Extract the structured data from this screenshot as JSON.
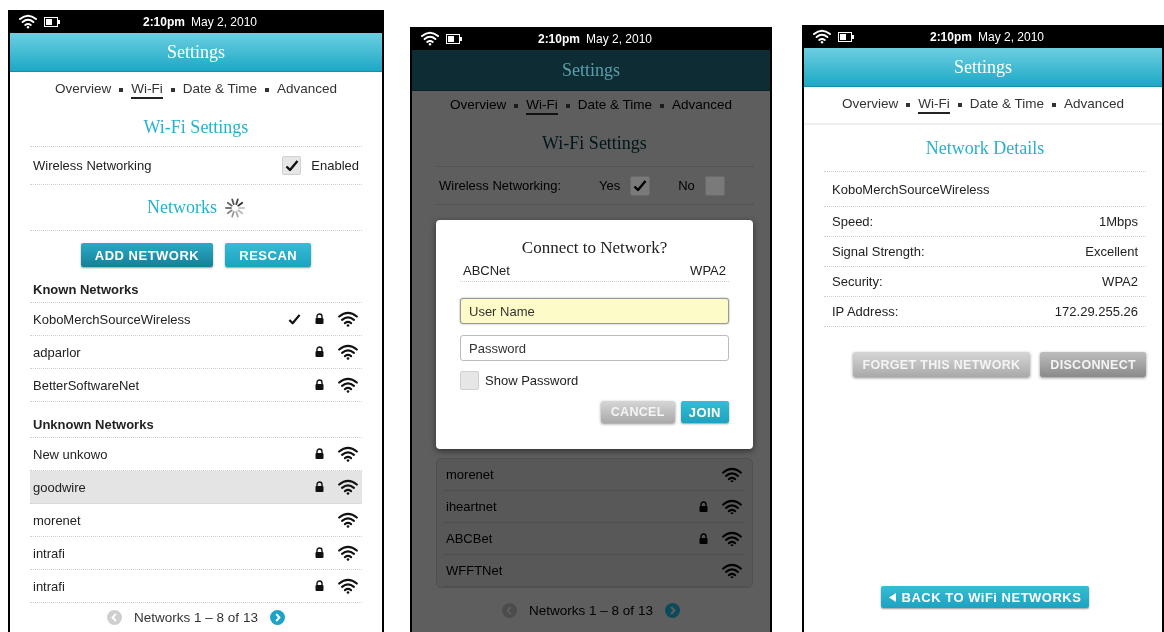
{
  "screens": [
    {
      "kind": "wifi_settings",
      "status_bar": {
        "time": "2:10pm",
        "date": "May 2, 2010"
      },
      "header": "Settings",
      "tabs": [
        {
          "label": "Overview",
          "selected": false
        },
        {
          "label": "Wi-Fi",
          "selected": true
        },
        {
          "label": "Date & Time",
          "selected": false
        },
        {
          "label": "Advanced",
          "selected": false
        }
      ],
      "section_title": "Wi-Fi Settings",
      "wireless": {
        "label": "Wireless Networking",
        "checked": true,
        "option": "Enabled"
      },
      "networks_title": "Networks",
      "loading": true,
      "buttons": [
        "ADD NETWORK",
        "RESCAN"
      ],
      "groups": [
        {
          "title": "Known Networks",
          "networks": [
            {
              "name": "KoboMerchSourceWireless",
              "connected": true,
              "locked": true,
              "selected": false
            },
            {
              "name": "adparlor",
              "connected": false,
              "locked": true,
              "selected": false
            },
            {
              "name": "BetterSoftwareNet",
              "connected": false,
              "locked": true,
              "selected": false
            }
          ]
        },
        {
          "title": "Unknown Networks",
          "networks": [
            {
              "name": "New unkowo",
              "connected": false,
              "locked": true,
              "selected": false
            },
            {
              "name": "goodwire",
              "connected": false,
              "locked": true,
              "selected": true
            },
            {
              "name": "morenet",
              "connected": false,
              "locked": false,
              "selected": false
            },
            {
              "name": "intrafi",
              "connected": false,
              "locked": true,
              "selected": false
            },
            {
              "name": "intrafi",
              "connected": false,
              "locked": true,
              "selected": false
            }
          ]
        }
      ],
      "pager": {
        "text": "Networks 1 – 8 of 13",
        "prev_disabled": true,
        "next_disabled": false
      }
    },
    {
      "kind": "connect_dialog",
      "status_bar": {
        "time": "2:10pm",
        "date": "May 2, 2010"
      },
      "header": "Settings",
      "tabs": [
        {
          "label": "Overview",
          "selected": false
        },
        {
          "label": "Wi-Fi",
          "selected": true
        },
        {
          "label": "Date & Time",
          "selected": false
        },
        {
          "label": "Advanced",
          "selected": false
        }
      ],
      "section_title": "Wi-Fi Settings",
      "wireless": {
        "label": "Wireless Networking:",
        "options": [
          {
            "label": "Yes",
            "checked": true
          },
          {
            "label": "No",
            "checked": false
          }
        ]
      },
      "dialog": {
        "title": "Connect to Network?",
        "network": "ABCNet",
        "security": "WPA2",
        "fields": [
          {
            "placeholder": "User Name",
            "focused": true
          },
          {
            "placeholder": "Password",
            "focused": false
          }
        ],
        "show_password": {
          "label": "Show Password",
          "checked": false
        },
        "buttons": [
          {
            "label": "CANCEL",
            "kind": "secondary"
          },
          {
            "label": "JOIN",
            "kind": "primary"
          }
        ]
      },
      "networks": [
        {
          "name": "morenet",
          "locked": false
        },
        {
          "name": "iheartnet",
          "locked": true
        },
        {
          "name": "ABCBet",
          "locked": true
        },
        {
          "name": "WFFTNet",
          "locked": false
        }
      ],
      "pager": {
        "text": "Networks 1 – 8 of 13",
        "prev_disabled": true,
        "next_disabled": false
      }
    },
    {
      "kind": "network_details",
      "status_bar": {
        "time": "2:10pm",
        "date": "May 2, 2010"
      },
      "header": "Settings",
      "tabs": [
        {
          "label": "Overview",
          "selected": false
        },
        {
          "label": "Wi-Fi",
          "selected": true
        },
        {
          "label": "Date & Time",
          "selected": false
        },
        {
          "label": "Advanced",
          "selected": false
        }
      ],
      "section_title": "Network Details",
      "network": "KoboMerchSourceWireless",
      "details": [
        {
          "label": "Speed:",
          "value": "1Mbps"
        },
        {
          "label": "Signal Strength:",
          "value": "Excellent"
        },
        {
          "label": "Security:",
          "value": "WPA2"
        },
        {
          "label": "IP Address:",
          "value": "172.29.255.26"
        }
      ],
      "buttons": [
        {
          "label": "FORGET THIS NETWORK",
          "kind": "light"
        },
        {
          "label": "DISCONNECT",
          "kind": "dark"
        }
      ],
      "back_button": "BACK TO WiFi NETWORKS"
    }
  ]
}
